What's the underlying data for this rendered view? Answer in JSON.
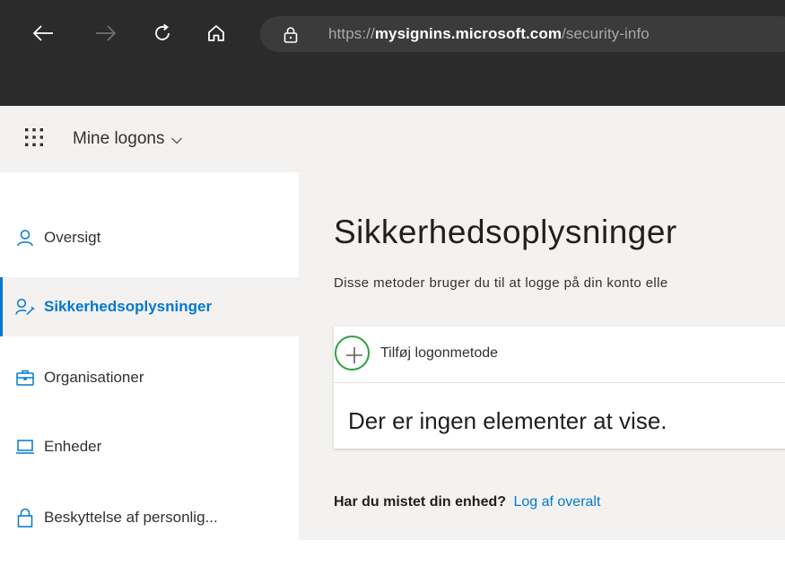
{
  "browser": {
    "url_scheme": "https://",
    "url_host": "mysignins.microsoft.com",
    "url_path": "/security-info",
    "icons": [
      "back-icon",
      "forward-icon",
      "refresh-icon",
      "home-icon",
      "lock-icon"
    ]
  },
  "header": {
    "app_title": "Mine logons"
  },
  "sidebar": {
    "items": [
      {
        "label": "Oversigt",
        "icon": "person-icon"
      },
      {
        "label": "Sikkerhedsoplysninger",
        "icon": "security-info-icon",
        "active": true
      },
      {
        "label": "Organisationer",
        "icon": "briefcase-icon"
      },
      {
        "label": "Enheder",
        "icon": "laptop-icon"
      },
      {
        "label": "Beskyttelse af personlig...",
        "icon": "lock-icon"
      }
    ]
  },
  "main": {
    "title": "Sikkerhedsoplysninger",
    "description": "Disse metoder bruger du til at logge på din konto elle",
    "add_method_label": "Tilføj logonmetode",
    "empty_message": "Der er ingen elementer at vise.",
    "lost_device_question": "Har du mistet din enhed?",
    "sign_out_link": "Log af overalt"
  },
  "colors": {
    "accent": "#0078d4",
    "highlight_ring": "#2ea043",
    "chrome_bg": "#2b2b2b",
    "header_bg": "#f3f2f1"
  }
}
